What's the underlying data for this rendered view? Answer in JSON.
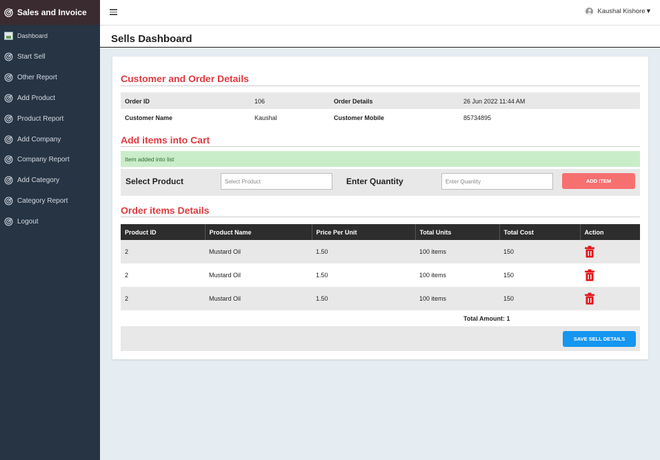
{
  "app": {
    "title": "Sales and Invoice"
  },
  "sidebar": {
    "items": [
      {
        "label": "Dashboard",
        "icon": "image-icon"
      },
      {
        "label": "Start Sell",
        "icon": "target-icon"
      },
      {
        "label": "Other Report",
        "icon": "target-icon"
      },
      {
        "label": "Add Product",
        "icon": "target-icon"
      },
      {
        "label": "Product Report",
        "icon": "target-icon"
      },
      {
        "label": "Add Company",
        "icon": "target-icon"
      },
      {
        "label": "Company Report",
        "icon": "target-icon"
      },
      {
        "label": "Add Category",
        "icon": "target-icon"
      },
      {
        "label": "Category Report",
        "icon": "target-icon"
      },
      {
        "label": "Logout",
        "icon": "target-icon"
      }
    ]
  },
  "topbar": {
    "user_name": "Kaushal Kishore▼"
  },
  "page": {
    "title": "Sells Dashboard"
  },
  "customer_section": {
    "title": "Customer and Order Details",
    "order_id_label": "Order ID",
    "order_id": "106",
    "order_details_label": "Order Details",
    "order_details": "26 Jun 2022 11:44 AM",
    "customer_name_label": "Customer Name",
    "customer_name": "Kaushal",
    "customer_mobile_label": "Customer Mobile",
    "customer_mobile": "85734895"
  },
  "cart_section": {
    "title": "Add items into Cart",
    "alert": "Item added into list",
    "select_product_label": "Select Product",
    "select_product_placeholder": "Select Product",
    "quantity_label": "Enter Quantity",
    "quantity_placeholder": "Enter Quantity",
    "add_button": "ADD ITEM"
  },
  "order_items": {
    "title": "Order items Details",
    "columns": [
      "Product ID",
      "Product Name",
      "Price Per Unit",
      "Total Units",
      "Total Cost",
      "Action"
    ],
    "rows": [
      [
        "2",
        "Mustard Oil",
        "1.50",
        "100 items",
        "150"
      ],
      [
        "2",
        "Mustard Oil",
        "1.50",
        "100 items",
        "150"
      ],
      [
        "2",
        "Mustard Oil",
        "1.50",
        "100 items",
        "150"
      ]
    ],
    "total": "Total Amount: 1",
    "save_button": "SAVE SELL DETAILS"
  },
  "colors": {
    "sidebar_bg": "#263444",
    "brand_bg": "#3a2b30",
    "section_title": "#e0393e",
    "add_button": "#f67070",
    "save_button": "#1596f0",
    "alert_bg": "#c9edc9",
    "trash": "#e8141a"
  }
}
